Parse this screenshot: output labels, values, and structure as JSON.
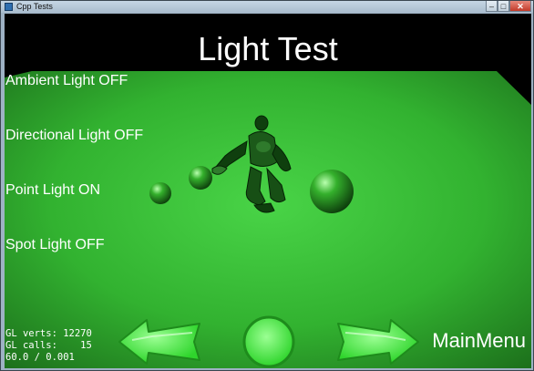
{
  "window": {
    "title": "Cpp Tests",
    "controls": {
      "minimize": "–",
      "maximize": "□",
      "close": "✕"
    }
  },
  "scene": {
    "title": "Light Test",
    "menu": {
      "ambient": "Ambient Light OFF",
      "directional": "Directional Light OFF",
      "point": "Point Light ON",
      "spot": "Spot Light OFF"
    },
    "main_menu": "MainMenu"
  },
  "stats": {
    "line1": "GL verts: 12270",
    "line2": "GL calls:    15",
    "line3": "60.0 / 0.001"
  },
  "icons": {
    "back": "left-arrow-icon",
    "restart": "circle-icon",
    "next": "right-arrow-icon"
  },
  "colors": {
    "ground": "#2ea82c",
    "button": "#4cff4c",
    "window_chrome": "#9eb2c4"
  }
}
